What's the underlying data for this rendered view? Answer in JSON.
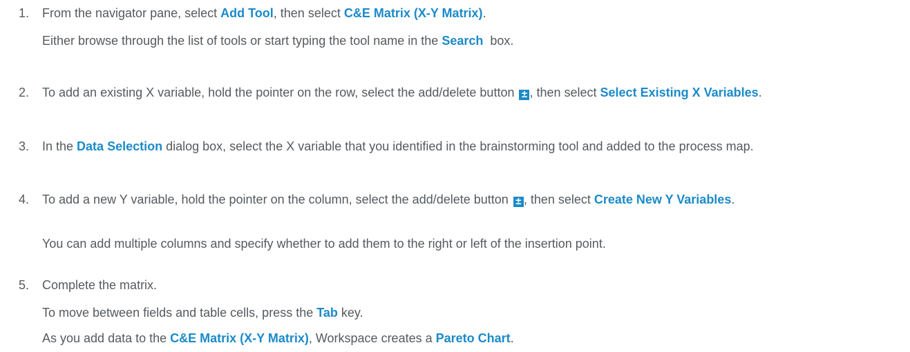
{
  "steps": [
    {
      "number": "1.",
      "line1": {
        "t1": "From the navigator pane, select ",
        "k1": "Add Tool",
        "t2": ", then select ",
        "k2": "C&E Matrix (X-Y Matrix)",
        "t3": "."
      },
      "line2": {
        "t1": "Either browse through the list of tools or start typing the tool name in the ",
        "k1": "Search",
        "t2": "  box."
      }
    },
    {
      "number": "2.",
      "t1": "To add an existing X variable, hold the pointer on the row, select the add/delete button ",
      "icon": "±",
      "t2": ", then select ",
      "k1": "Select Existing X Variables",
      "t3": "."
    },
    {
      "number": "3.",
      "t1": "In the ",
      "k1": "Data Selection",
      "t2": " dialog box, select the X variable that you identified in the brainstorming tool and added to the process map."
    },
    {
      "number": "4.",
      "t1": "To add a new Y variable, hold the pointer on the column, select the add/delete button ",
      "icon": "±",
      "t2": ", then select ",
      "k1": "Create New Y Variables",
      "t3": ".",
      "note": "You can add multiple columns and specify whether to add them to the right or left of the insertion point."
    },
    {
      "number": "5.",
      "line1": "Complete the matrix.",
      "line2": {
        "t1": "To move between fields and table cells, press the ",
        "k1": "Tab",
        "t2": " key."
      },
      "line3": {
        "t1": "As you add data to the ",
        "k1": "C&E Matrix (X-Y Matrix)",
        "t2": ", Workspace creates a ",
        "k2": "Pareto Chart",
        "t3": "."
      }
    }
  ],
  "colors": {
    "text": "#555a5e",
    "keyword": "#1b8ac9",
    "icon_bg": "#1b8ac9"
  },
  "icon_names": [
    "add-delete-icon"
  ]
}
